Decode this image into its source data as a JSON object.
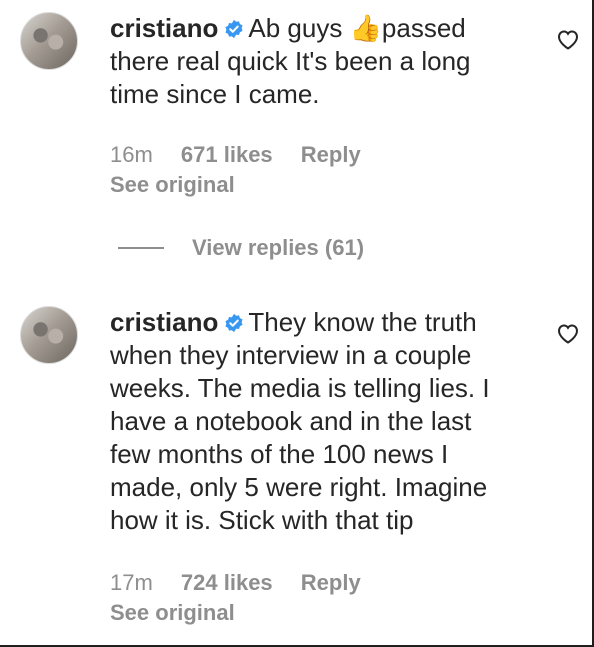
{
  "comments": [
    {
      "username": "cristiano",
      "text": "Ab guys 👍passed there real quick It's been a long time since I came.",
      "time": "16m",
      "likes": "671 likes",
      "reply_label": "Reply",
      "see_original_label": "See original"
    },
    {
      "username": "cristiano",
      "text": "They know the truth when they interview in a couple weeks. The media is telling lies. I have a notebook and in the last few months of the 100 news I made, only 5 were right. Imagine how it is. Stick with that tip",
      "time": "17m",
      "likes": "724 likes",
      "reply_label": "Reply",
      "see_original_label": "See original"
    }
  ],
  "view_replies_label": "View replies (61)",
  "colors": {
    "verified": "#3897f0",
    "meta_text": "#8e8e8e",
    "primary_text": "#262626"
  },
  "icons": {
    "verified": "verified-badge-icon",
    "like": "heart-outline-icon"
  }
}
